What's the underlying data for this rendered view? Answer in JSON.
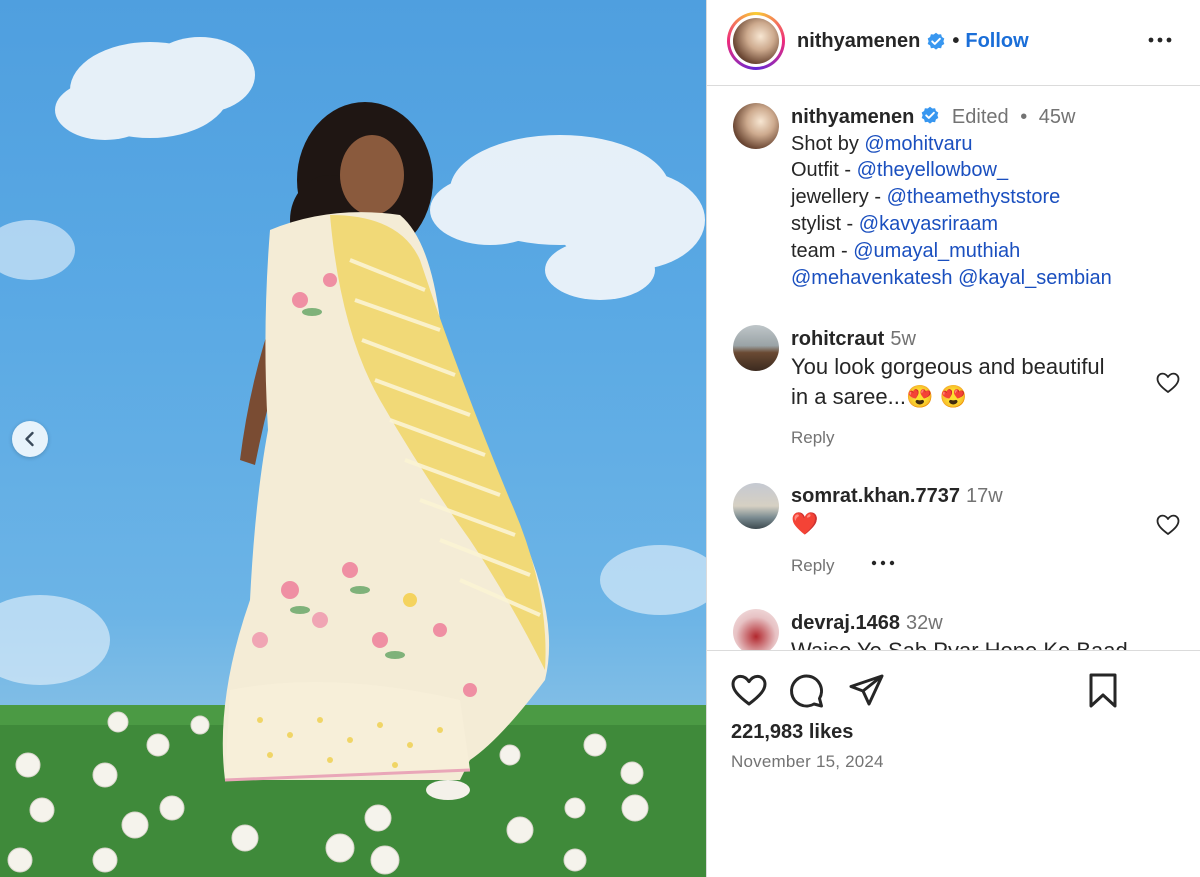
{
  "post": {
    "author": "nithyamenen",
    "follow_label": "Follow",
    "separator": "•",
    "photo_alt": "Woman in a yellow and floral saree"
  },
  "caption": {
    "user": "nithyamenen",
    "edited": "Edited",
    "separator": "•",
    "time": "45w",
    "line1_prefix": "Shot by ",
    "line1_mention": "@mohitvaru",
    "line2_prefix": "Outfit - ",
    "line2_mention": "@theyellowbow_",
    "line3_prefix": "jewellery - ",
    "line3_mention": "@theamethyststore",
    "line4_prefix": "stylist - ",
    "line4_mention": "@kavyasriraam",
    "line5_prefix": "team - ",
    "line5_mention": "@umayal_muthiah",
    "line6_mention_a": "@mehavenkatesh",
    "line6_mention_b": "@kayal_sembian"
  },
  "comments": [
    {
      "user": "rohitcraut",
      "time": "5w",
      "text_line1": "You look gorgeous and beautiful",
      "text_line2": "in a saree...😍 😍",
      "reply_label": "Reply"
    },
    {
      "user": "somrat.khan.7737",
      "time": "17w",
      "text_line1": "❤️",
      "reply_label": "Reply"
    },
    {
      "user": "devraj.1468",
      "time": "32w",
      "text_line1": "Waise Ye Sab Pyar Hone Ke Baad"
    }
  ],
  "footer": {
    "likes": "221,983 likes",
    "date": "November 15, 2024"
  },
  "colors": {
    "link": "#1a6ed8",
    "mention": "#1a4fbf",
    "verified": "#3897f0",
    "muted": "#737373"
  },
  "icons": [
    "chevron-left-icon",
    "verified-badge-icon",
    "more-horizontal-icon",
    "heart-icon",
    "comment-icon",
    "share-icon",
    "bookmark-icon"
  ]
}
